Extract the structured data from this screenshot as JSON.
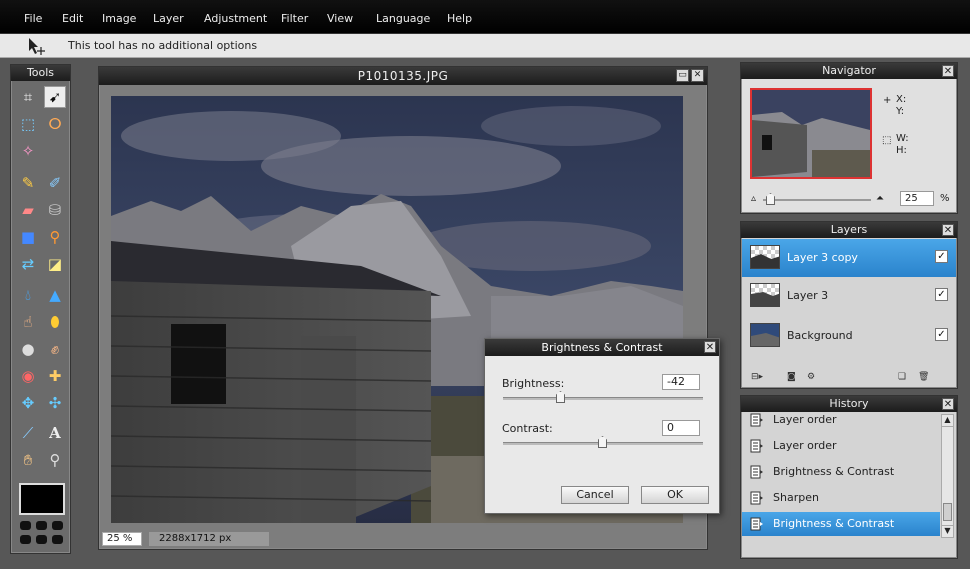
{
  "menu": [
    "File",
    "Edit",
    "Image",
    "Layer",
    "Adjustment",
    "Filter",
    "View",
    "Language",
    "Help"
  ],
  "options_bar": {
    "hint": "This tool has no additional options",
    "tool_icon": "move-tool-icon"
  },
  "tools_panel": {
    "title": "Tools",
    "tools": [
      "crop",
      "move",
      "marquee",
      "lasso",
      "magic-wand",
      "pencil",
      "brush",
      "eraser",
      "paint-bucket",
      "gradient",
      "stamp",
      "color-replace",
      "drawing",
      "blur",
      "sharpen",
      "smudge",
      "sponge",
      "red-eye",
      "dodge",
      "bloat",
      "pinch",
      "color-picker",
      "type",
      "hand",
      "zoom"
    ],
    "foreground_color": "#000000"
  },
  "image_window": {
    "title": "P1010135.JPG",
    "zoom": "25",
    "zoom_unit": "%",
    "dimensions": "2288x1712 px"
  },
  "dialog": {
    "title": "Brightness & Contrast",
    "brightness_label": "Brightness:",
    "brightness_value": "-42",
    "contrast_label": "Contrast:",
    "contrast_value": "0",
    "cancel_label": "Cancel",
    "ok_label": "OK"
  },
  "navigator": {
    "title": "Navigator",
    "x_label": "X:",
    "y_label": "Y:",
    "w_label": "W:",
    "h_label": "H:",
    "zoom_value": "25",
    "zoom_unit": "%"
  },
  "layers": {
    "title": "Layers",
    "items": [
      {
        "name": "Layer 3 copy",
        "selected": true,
        "visible": true
      },
      {
        "name": "Layer 3",
        "selected": false,
        "visible": true
      },
      {
        "name": "Background",
        "selected": false,
        "visible": true
      }
    ]
  },
  "history": {
    "title": "History",
    "items": [
      {
        "label": "Layer order",
        "selected": false
      },
      {
        "label": "Layer order",
        "selected": false
      },
      {
        "label": "Brightness & Contrast",
        "selected": false
      },
      {
        "label": "Sharpen",
        "selected": false
      },
      {
        "label": "Brightness & Contrast",
        "selected": true
      }
    ]
  },
  "colors": {
    "selection_blue": "#2a83cc",
    "panel_dark": "#1c1c1c"
  }
}
